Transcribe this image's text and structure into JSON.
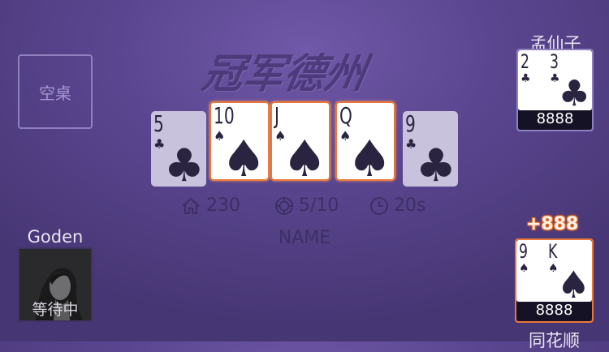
{
  "logo": {
    "text": "冠军德州"
  },
  "empty_seat": {
    "label": "空桌"
  },
  "community_cards": [
    {
      "rank": "5",
      "suit": "♣",
      "dimmed": true,
      "highlighted": false
    },
    {
      "rank": "10",
      "suit": "♠",
      "dimmed": false,
      "highlighted": true
    },
    {
      "rank": "J",
      "suit": "♠",
      "dimmed": false,
      "highlighted": true
    },
    {
      "rank": "Q",
      "suit": "♠",
      "dimmed": false,
      "highlighted": true
    },
    {
      "rank": "9",
      "suit": "♣",
      "dimmed": true,
      "highlighted": false
    }
  ],
  "table_info": {
    "room_number": "230",
    "blinds": "5/10",
    "timer": "20s",
    "table_name": "NAME"
  },
  "players": {
    "left": {
      "name": "Goden",
      "status": "等待中"
    },
    "top_right": {
      "name": "孟仙子",
      "chips": "8888",
      "cards": [
        {
          "rank": "2",
          "suit": "♣"
        },
        {
          "rank": "3",
          "suit": "♣"
        }
      ]
    },
    "bottom_right": {
      "win_amount": "+888",
      "chips": "8888",
      "hand_name": "同花顺",
      "cards": [
        {
          "rank": "9",
          "suit": "♠"
        },
        {
          "rank": "K",
          "suit": "♠"
        }
      ]
    }
  },
  "colors": {
    "highlight": "#e9783a",
    "felt": "#5a4690"
  }
}
